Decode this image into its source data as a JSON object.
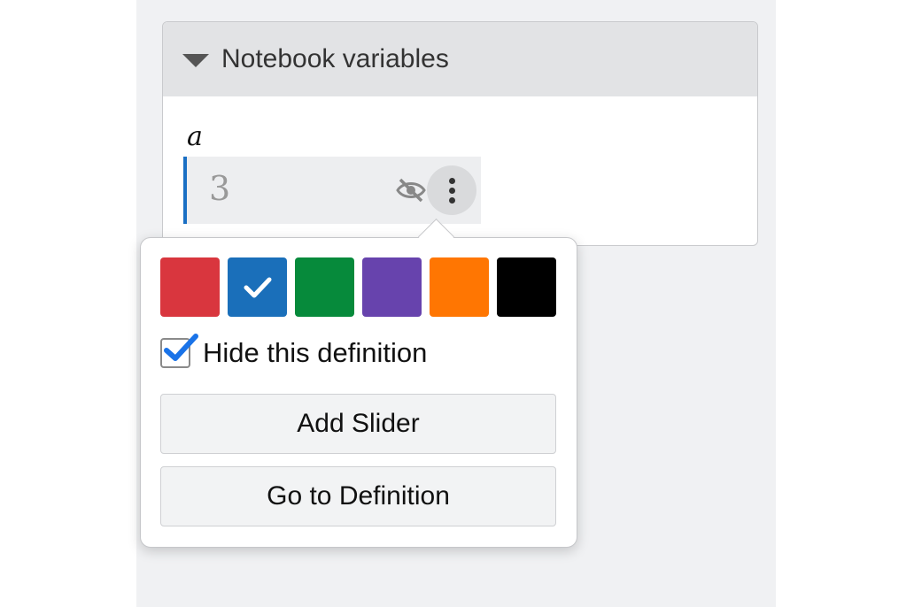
{
  "notebook": {
    "title": "Notebook variables",
    "variable": {
      "name": "a",
      "value": "3"
    }
  },
  "menu": {
    "colors": [
      {
        "name": "red",
        "hex": "#d9363e",
        "selected": false
      },
      {
        "name": "blue",
        "hex": "#1a6fba",
        "selected": true
      },
      {
        "name": "green",
        "hex": "#068a3b",
        "selected": false
      },
      {
        "name": "purple",
        "hex": "#6743ad",
        "selected": false
      },
      {
        "name": "orange",
        "hex": "#ff7602",
        "selected": false
      },
      {
        "name": "black",
        "hex": "#000000",
        "selected": false
      }
    ],
    "hide_label": "Hide this definition",
    "hide_checked": true,
    "add_slider_label": "Add Slider",
    "goto_label": "Go to Definition"
  },
  "icons": [
    "caret-down-icon",
    "eye-slash-icon",
    "more-vertical-icon",
    "checkmark-icon"
  ]
}
